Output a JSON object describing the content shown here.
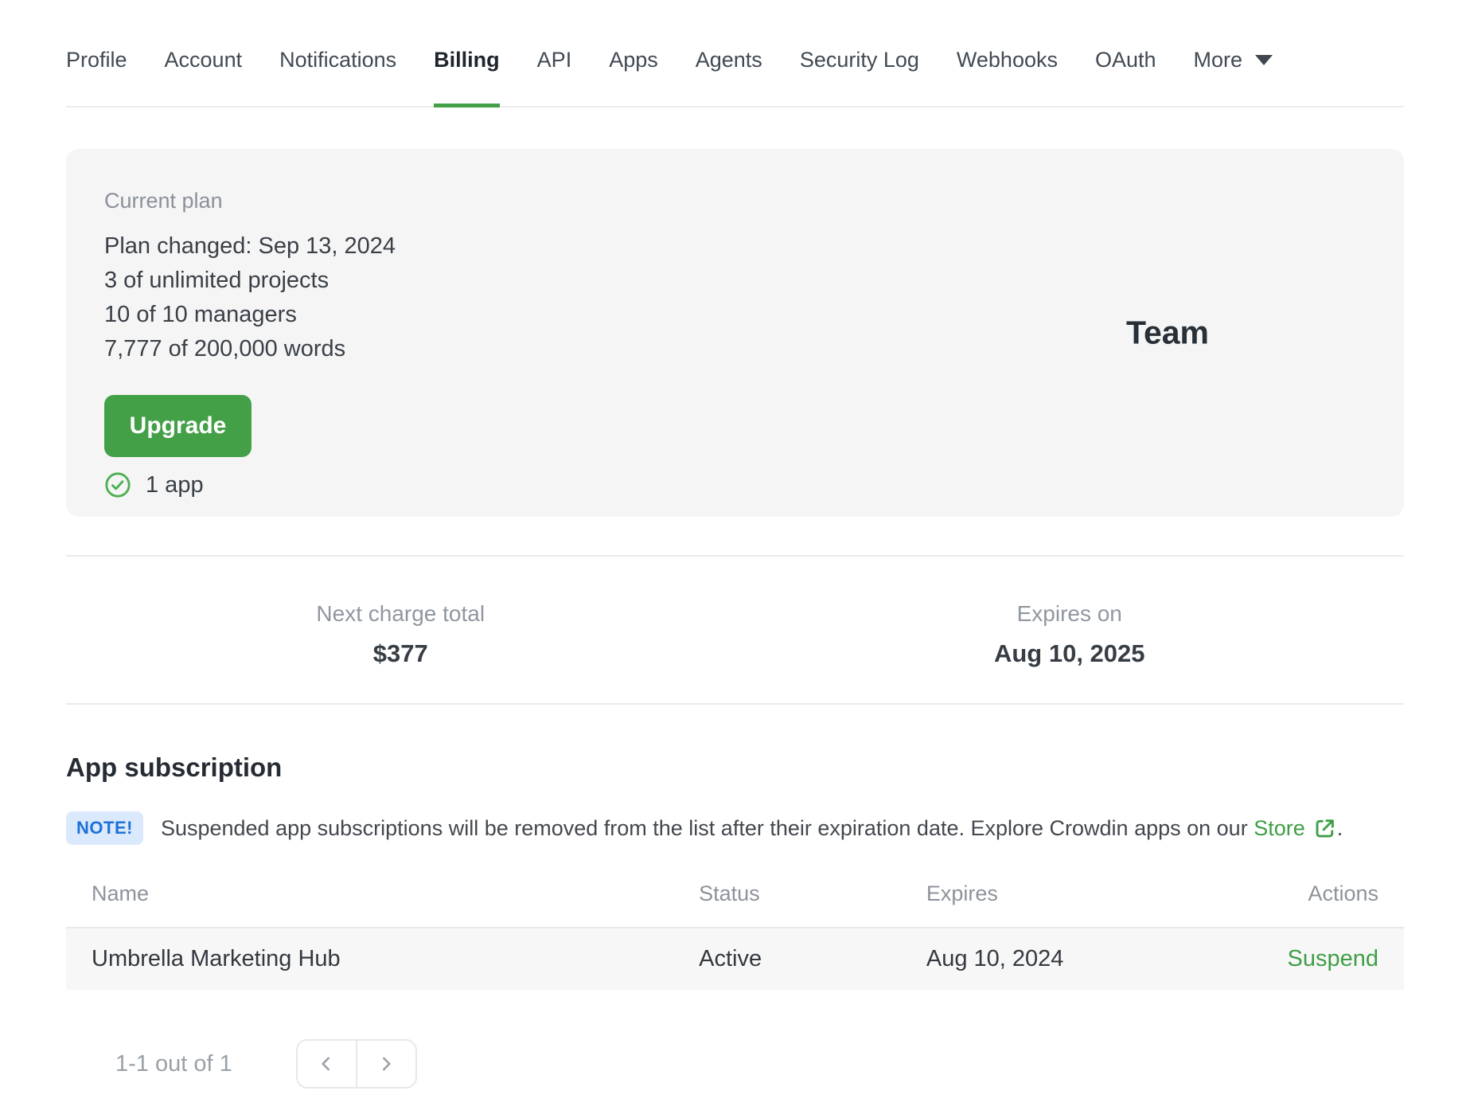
{
  "nav": {
    "tabs": [
      {
        "label": "Profile",
        "active": false
      },
      {
        "label": "Account",
        "active": false
      },
      {
        "label": "Notifications",
        "active": false
      },
      {
        "label": "Billing",
        "active": true
      },
      {
        "label": "API",
        "active": false
      },
      {
        "label": "Apps",
        "active": false
      },
      {
        "label": "Agents",
        "active": false
      },
      {
        "label": "Security Log",
        "active": false
      },
      {
        "label": "Webhooks",
        "active": false
      },
      {
        "label": "OAuth",
        "active": false
      }
    ],
    "more_label": "More"
  },
  "plan_card": {
    "label": "Current plan",
    "lines": {
      "0": "Plan changed: Sep 13, 2024",
      "1": "3 of unlimited projects",
      "2": "10 of 10 managers",
      "3": "7,777 of 200,000 words"
    },
    "upgrade_label": "Upgrade",
    "apps_label": "1 app",
    "plan_name": "Team"
  },
  "billing_summary": {
    "next_charge_label": "Next charge total",
    "next_charge_value": "$377",
    "expires_label": "Expires on",
    "expires_value": "Aug 10, 2025"
  },
  "app_subscription": {
    "title": "App subscription",
    "note_badge": "NOTE!",
    "note_text_before": "Suspended app subscriptions will be removed from the list after their expiration date. Explore Crowdin apps on our ",
    "store_link_label": "Store",
    "note_text_after": ".",
    "table": {
      "headers": {
        "0": "Name",
        "1": "Status",
        "2": "Expires",
        "3": "Actions"
      },
      "rows": {
        "0": {
          "name": "Umbrella Marketing Hub",
          "status": "Active",
          "expires": "Aug 10, 2024",
          "action": "Suspend"
        }
      }
    },
    "pagination": {
      "label": "1-1 out of 1"
    }
  },
  "colors": {
    "accent_green": "#43a047",
    "link_green": "#3f9e46",
    "active_tab_underline": "#43a047",
    "note_badge_bg": "#dbe9fc",
    "note_badge_text": "#1d71d8",
    "card_bg": "#f5f5f6",
    "table_row_bg": "#f7f7f8"
  }
}
